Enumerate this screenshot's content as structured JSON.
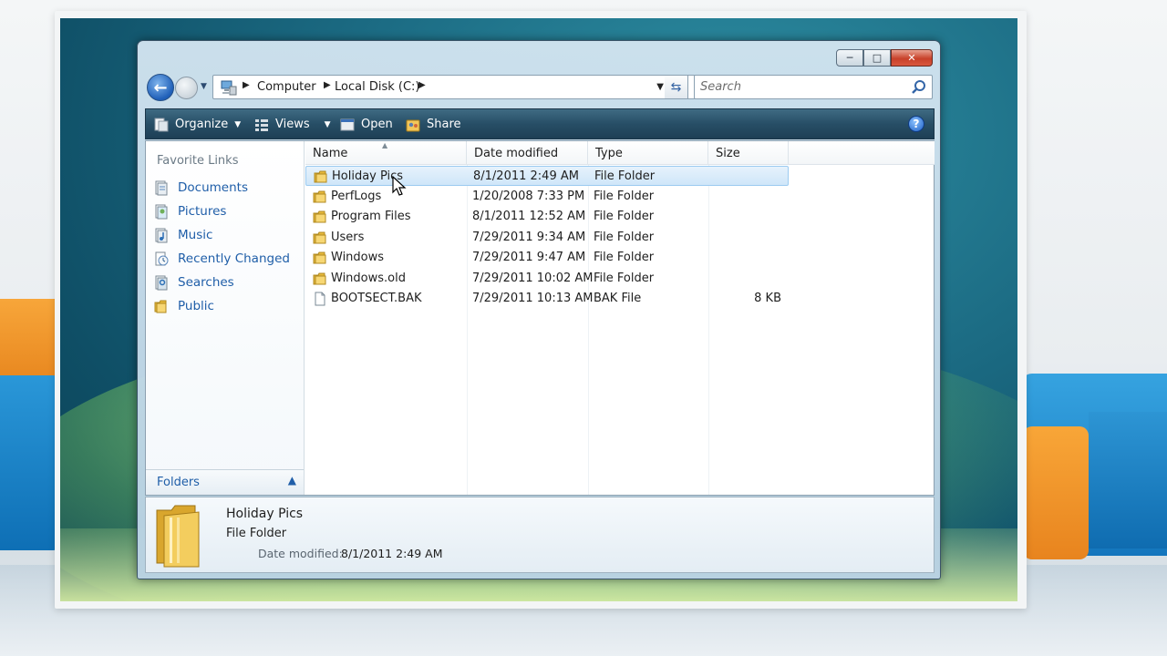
{
  "address": {
    "crumbs": [
      "Computer",
      "Local Disk (C:)"
    ]
  },
  "search": {
    "placeholder": "Search"
  },
  "toolbar": {
    "organize": "Organize",
    "views": "Views",
    "open": "Open",
    "share": "Share",
    "help": "?"
  },
  "navpane": {
    "title": "Favorite Links",
    "items": [
      {
        "label": "Documents",
        "icon": "documents-icon"
      },
      {
        "label": "Pictures",
        "icon": "pictures-icon"
      },
      {
        "label": "Music",
        "icon": "music-icon"
      },
      {
        "label": "Recently Changed",
        "icon": "recently-changed-icon"
      },
      {
        "label": "Searches",
        "icon": "searches-icon"
      },
      {
        "label": "Public",
        "icon": "folder-icon"
      }
    ],
    "folders_label": "Folders"
  },
  "columns": {
    "name": "Name",
    "date": "Date modified",
    "type": "Type",
    "size": "Size"
  },
  "files": [
    {
      "name": "Holiday Pics",
      "date": "8/1/2011 2:49 AM",
      "type": "File Folder",
      "size": "",
      "icon": "folder-icon",
      "selected": true
    },
    {
      "name": "PerfLogs",
      "date": "1/20/2008 7:33 PM",
      "type": "File Folder",
      "size": "",
      "icon": "folder-icon"
    },
    {
      "name": "Program Files",
      "date": "8/1/2011 12:52 AM",
      "type": "File Folder",
      "size": "",
      "icon": "folder-icon"
    },
    {
      "name": "Users",
      "date": "7/29/2011 9:34 AM",
      "type": "File Folder",
      "size": "",
      "icon": "folder-icon"
    },
    {
      "name": "Windows",
      "date": "7/29/2011 9:47 AM",
      "type": "File Folder",
      "size": "",
      "icon": "folder-icon"
    },
    {
      "name": "Windows.old",
      "date": "7/29/2011 10:02 AM",
      "type": "File Folder",
      "size": "",
      "icon": "folder-icon"
    },
    {
      "name": "BOOTSECT.BAK",
      "date": "7/29/2011 10:13 AM",
      "type": "BAK File",
      "size": "8 KB",
      "icon": "file-icon"
    }
  ],
  "details": {
    "name": "Holiday Pics",
    "type": "File Folder",
    "modified_label": "Date modified:",
    "modified_value": "8/1/2011 2:49 AM"
  },
  "colors": {
    "link_blue": "#1f5ea8",
    "toolbar_dark": "#274e66",
    "selection": "#cfe6f9",
    "folder_yellow": "#f3c84e"
  }
}
